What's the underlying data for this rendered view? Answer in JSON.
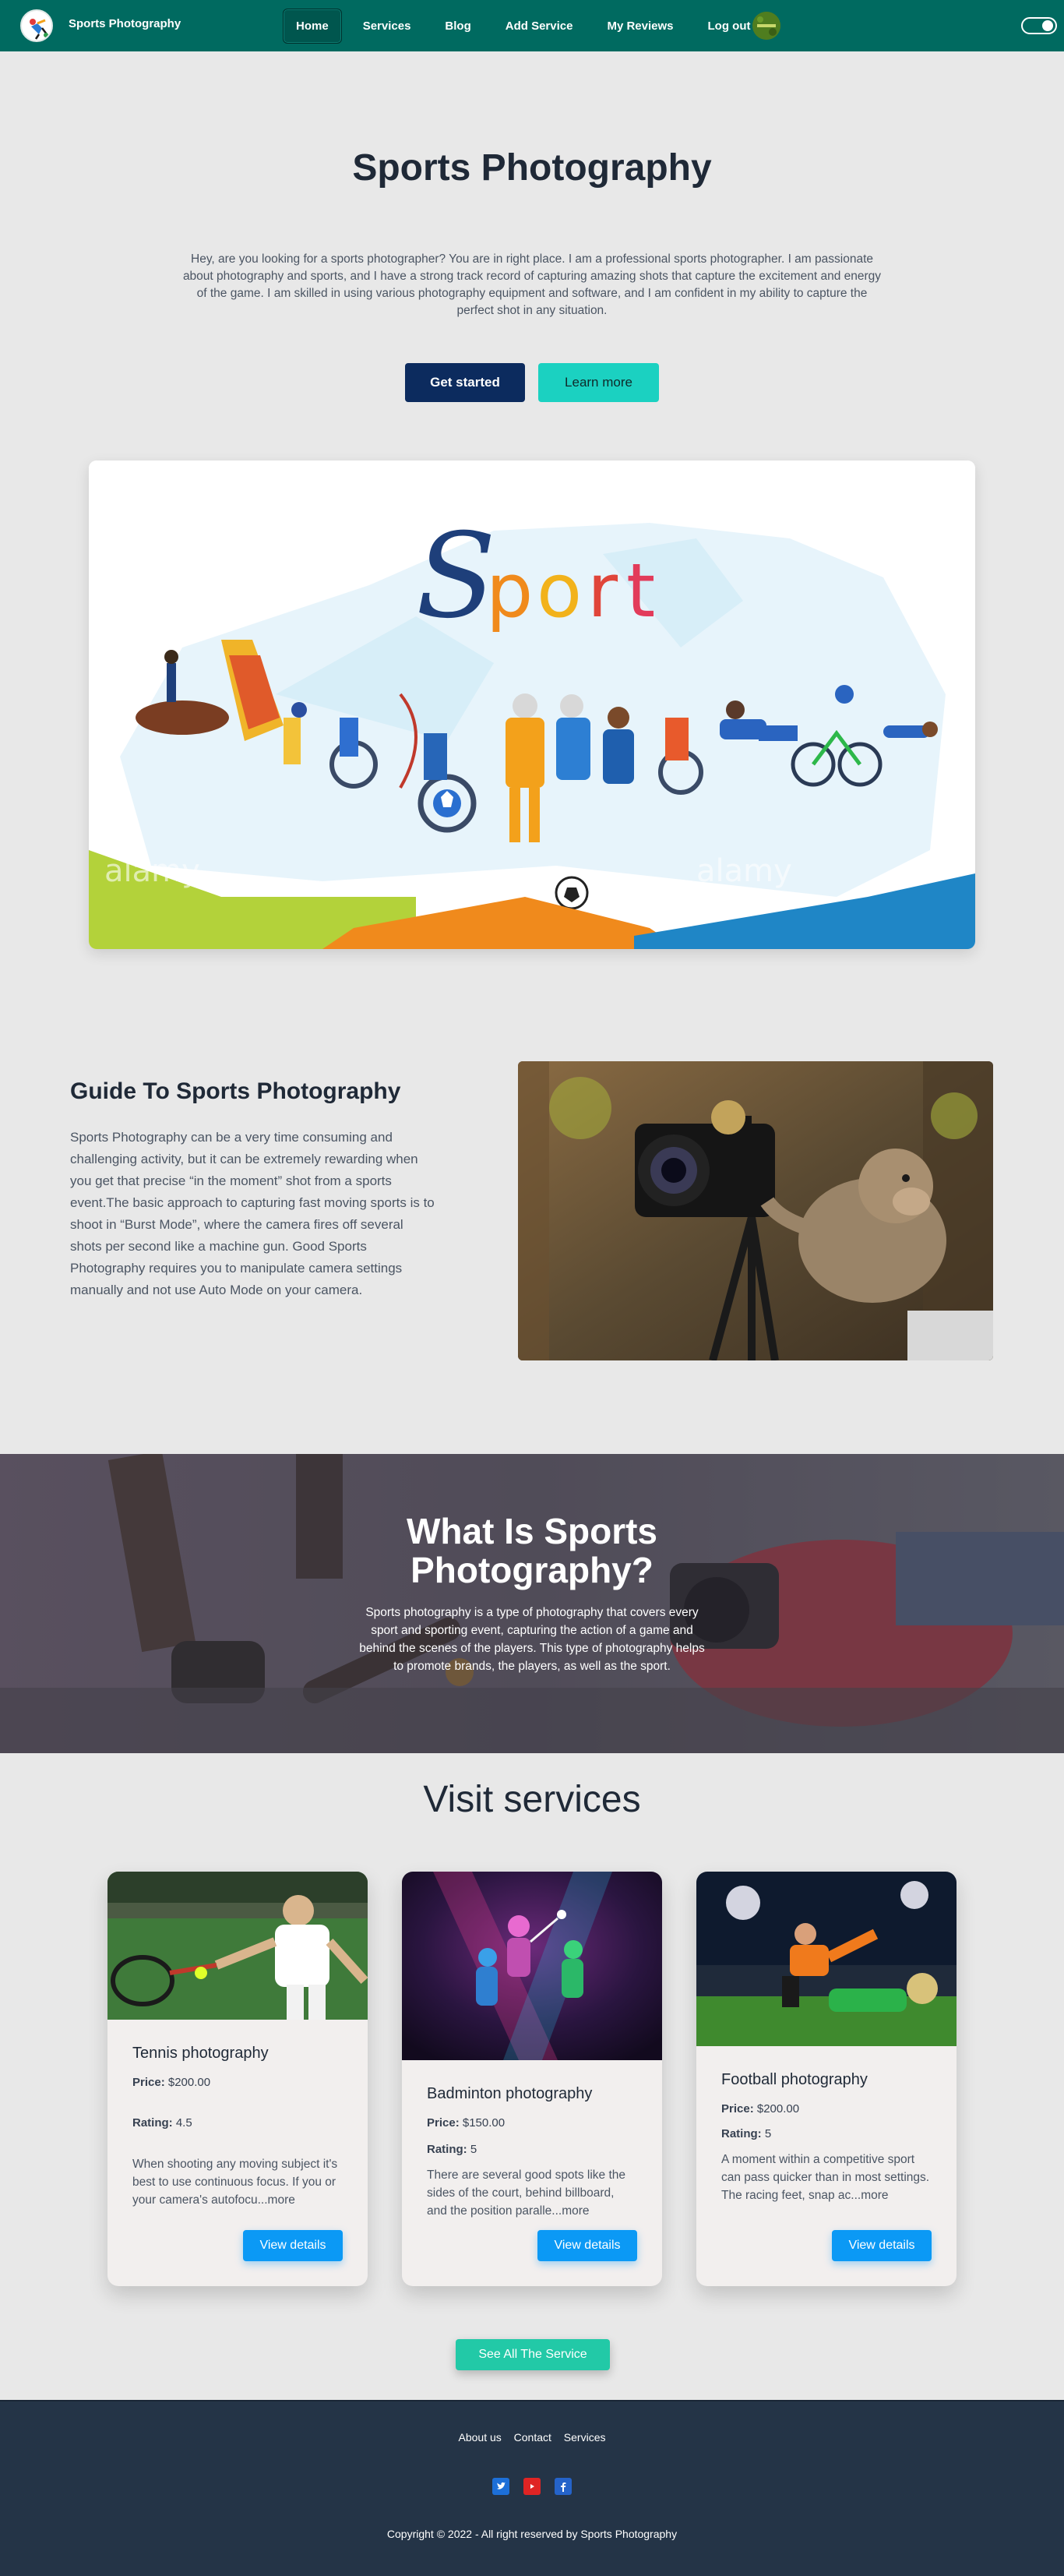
{
  "nav": {
    "brand": "Sports Photography",
    "links": [
      "Home",
      "Services",
      "Blog",
      "Add Service",
      "My Reviews",
      "Log out"
    ]
  },
  "hero": {
    "title": "Sports Photography",
    "text": "Hey, are you looking for a sports photographer? You are in right place. I am a professional sports photographer. I am passionate about photography and sports, and I have a strong track record of capturing amazing shots that capture the excitement and energy of the game. I am skilled in using various photography equipment and software, and I am confident in my ability to capture the perfect shot in any situation.",
    "primary_button": "Get started",
    "secondary_button": "Learn more",
    "image_word": "Sport",
    "watermark": "alamy"
  },
  "guide": {
    "title": "Guide To Sports Photography",
    "text": "Sports Photography can be a very time consuming and challenging activity, but it can be extremely rewarding when you get that precise “in the moment” shot from a sports event.The basic approach to capturing fast moving sports is to shoot in “Burst Mode”, where the camera fires off several shots per second like a machine gun. Good Sports Photography requires you to manipulate camera settings manually and not use Auto Mode on your camera."
  },
  "what_is": {
    "title_line1": "What Is Sports",
    "title_line2": "Photography?",
    "text": "Sports photography is a type of photography that covers every sport and sporting event, capturing the action of a game and behind the scenes of the players. This type of photography helps to promote brands, the players, as well as the sport."
  },
  "services": {
    "title": "Visit services",
    "price_label": "Price:",
    "rating_label": "Rating:",
    "button": "View details",
    "cards": [
      {
        "title": "Tennis photography",
        "price": "$200.00",
        "rating": "4.5",
        "desc": "When shooting any moving subject it's best to use continuous focus. If you or your camera's autofocu...more"
      },
      {
        "title": "Badminton photography",
        "price": "$150.00",
        "rating": "5",
        "desc": "There are several good spots like the sides of the court, behind billboard, and the position paralle...more"
      },
      {
        "title": "Football photography",
        "price": "$200.00",
        "rating": "5",
        "desc": "A moment within a competitive sport can pass quicker than in most settings. The racing feet, snap ac...more"
      }
    ],
    "see_all": "See All The Service"
  },
  "footer": {
    "links": [
      "About us",
      "Contact",
      "Services"
    ],
    "social": [
      {
        "icon": "twitter-icon",
        "glyph": "t",
        "color": "#1d6fd8"
      },
      {
        "icon": "youtube-icon",
        "glyph": "▶",
        "color": "#e02424"
      },
      {
        "icon": "facebook-icon",
        "glyph": "f",
        "color": "#2563c9"
      }
    ],
    "copyright": "Copyright © 2022 - All right reserved by Sports Photography"
  },
  "colors": {
    "navbar": "#006a60",
    "primary_button": "#0c2b5e",
    "secondary_button": "#1bd1c1",
    "card_button": "#0b99f5",
    "see_all_button": "#22c9a7",
    "footer": "#243447"
  }
}
